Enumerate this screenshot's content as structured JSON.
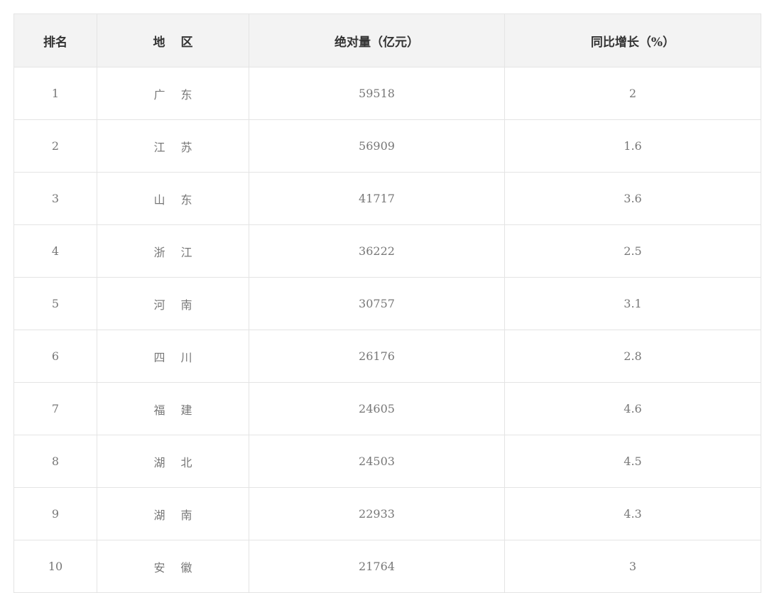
{
  "table": {
    "headers": {
      "rank": "排名",
      "region": "地区",
      "absolute": "绝对量（亿元）",
      "growth": "同比增长（%）"
    },
    "rows": [
      {
        "rank": "1",
        "region": "广东",
        "absolute": "59518",
        "growth": "2"
      },
      {
        "rank": "2",
        "region": "江苏",
        "absolute": "56909",
        "growth": "1.6"
      },
      {
        "rank": "3",
        "region": "山东",
        "absolute": "41717",
        "growth": "3.6"
      },
      {
        "rank": "4",
        "region": "浙江",
        "absolute": "36222",
        "growth": "2.5"
      },
      {
        "rank": "5",
        "region": "河南",
        "absolute": "30757",
        "growth": "3.1"
      },
      {
        "rank": "6",
        "region": "四川",
        "absolute": "26176",
        "growth": "2.8"
      },
      {
        "rank": "7",
        "region": "福建",
        "absolute": "24605",
        "growth": "4.6"
      },
      {
        "rank": "8",
        "region": "湖北",
        "absolute": "24503",
        "growth": "4.5"
      },
      {
        "rank": "9",
        "region": "湖南",
        "absolute": "22933",
        "growth": "4.3"
      },
      {
        "rank": "10",
        "region": "安徽",
        "absolute": "21764",
        "growth": "3"
      }
    ]
  }
}
